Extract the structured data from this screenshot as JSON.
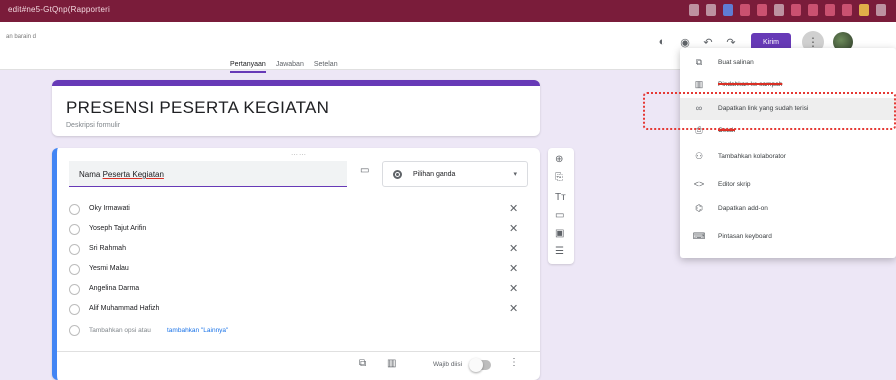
{
  "window": {
    "title": "edit#ne5-GtQnp(Rapporteri"
  },
  "header": {
    "doc_name": "an barain\nd",
    "send_label": "Kirim",
    "more_label": "⋮",
    "tabs": [
      {
        "label": "Pertanyaan",
        "active": true
      },
      {
        "label": "Jawaban",
        "active": false
      },
      {
        "label": "Setelan",
        "active": false
      }
    ]
  },
  "form": {
    "title": "PRESENSI PESERTA KEGIATAN",
    "description_placeholder": "Deskripsi formulir"
  },
  "question": {
    "title_prefix": "Nama ",
    "title_underlined": "Peserta Kegiatan",
    "type": "Pilihan ganda",
    "options": [
      "Oky Irmawati",
      "Yoseph Tajut Arifin",
      "Sri Rahmah",
      "Yesmi Malau",
      "Angelina Darma",
      "Alif Muhammad Hafizh"
    ],
    "add_option": "Tambahkan opsi",
    "add_other_prefix": "atau",
    "add_other": "tambahkan \"Lainnya\"",
    "required_label": "Wajib diisi"
  },
  "menu": {
    "items": [
      {
        "icon": "copy-icon",
        "label": "Buat salinan"
      },
      {
        "icon": "trash-icon",
        "label": "Pindahkan ke sampah"
      },
      {
        "icon": "link-icon",
        "label": "Dapatkan link yang sudah terisi"
      },
      {
        "icon": "print-icon",
        "label": "Cetak"
      },
      {
        "icon": "add-collaborator-icon",
        "label": "Tambahkan kolaborator"
      },
      {
        "icon": "code-icon",
        "label": "Editor skrip"
      },
      {
        "icon": "addon-icon",
        "label": "Dapatkan add-on"
      },
      {
        "icon": "keyboard-icon",
        "label": "Pintasan keyboard"
      }
    ]
  },
  "colors": {
    "accent": "#673ab7",
    "titlebar": "#7a1c3a",
    "question_border": "#4285f4",
    "highlight": "#e53935"
  }
}
